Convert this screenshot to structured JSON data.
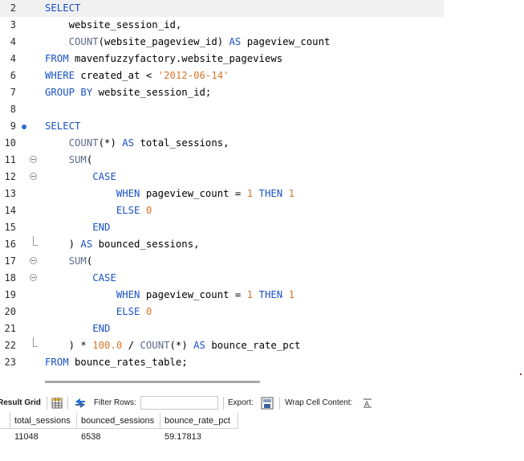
{
  "editor": {
    "lines": [
      {
        "n": "2",
        "html": "<span class=\"kw\">SELECT</span>"
      },
      {
        "n": "3",
        "html": "    website_session_id,"
      },
      {
        "n": "4",
        "html": "    <span class=\"fn\">COUNT</span>(website_pageview_id) <span class=\"kw\">AS</span> pageview_count"
      },
      {
        "n": "4",
        "html": "<span class=\"kw\">FROM</span> mavenfuzzyfactory.website_pageviews"
      },
      {
        "n": "6",
        "html": "<span class=\"kw\">WHERE</span> created_at &lt; <span class=\"str\">'2012-06-14'</span>"
      },
      {
        "n": "7",
        "html": "<span class=\"kw\">GROUP BY</span> website_session_id;"
      },
      {
        "n": "8",
        "html": ""
      },
      {
        "n": "9",
        "html": "<span class=\"kw\">SELECT</span>"
      },
      {
        "n": "10",
        "html": "    <span class=\"fn\">COUNT</span>(*) <span class=\"kw\">AS</span> total_sessions,"
      },
      {
        "n": "11",
        "html": "    <span class=\"fn\">SUM</span>("
      },
      {
        "n": "12",
        "html": "        <span class=\"kw\">CASE</span>"
      },
      {
        "n": "13",
        "html": "            <span class=\"kw\">WHEN</span> pageview_count = <span class=\"num\">1</span> <span class=\"kw\">THEN</span> <span class=\"num\">1</span>"
      },
      {
        "n": "14",
        "html": "            <span class=\"kw\">ELSE</span> <span class=\"num\">0</span>"
      },
      {
        "n": "15",
        "html": "        <span class=\"kw\">END</span>"
      },
      {
        "n": "16",
        "html": "    ) <span class=\"kw\">AS</span> bounced_sessions,"
      },
      {
        "n": "17",
        "html": "    <span class=\"fn\">SUM</span>("
      },
      {
        "n": "18",
        "html": "        <span class=\"kw\">CASE</span>"
      },
      {
        "n": "19",
        "html": "            <span class=\"kw\">WHEN</span> pageview_count = <span class=\"num\">1</span> <span class=\"kw\">THEN</span> <span class=\"num\">1</span>"
      },
      {
        "n": "20",
        "html": "            <span class=\"kw\">ELSE</span> <span class=\"num\">0</span>"
      },
      {
        "n": "21",
        "html": "        <span class=\"kw\">END</span>"
      },
      {
        "n": "22",
        "html": "    ) * <span class=\"num\">100.0</span> / <span class=\"fn\">COUNT</span>(*) <span class=\"kw\">AS</span> bounce_rate_pct"
      },
      {
        "n": "23",
        "html": "<span class=\"kw\">FROM</span> bounce_rates_table;"
      }
    ],
    "gutter": {
      "9": "bullet",
      "11": "fold",
      "12": "fold",
      "16": "fold-end",
      "17": "fold",
      "18": "fold",
      "22": "fold-end"
    }
  },
  "toolbar": {
    "result_grid": "Result Grid",
    "filter_rows": "Filter Rows:",
    "filter_value": "",
    "export": "Export:",
    "wrap": "Wrap Cell Content:"
  },
  "grid": {
    "columns": [
      "total_sessions",
      "bounced_sessions",
      "bounce_rate_pct"
    ],
    "rows": [
      [
        "11048",
        "6538",
        "59.17813"
      ]
    ]
  },
  "colors": {
    "keyword": "#1a52c4",
    "function": "#5d6b86",
    "string": "#d9772a",
    "accent": "#2a6fd6"
  }
}
